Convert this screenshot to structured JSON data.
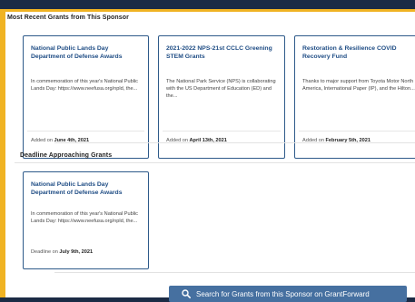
{
  "recent": {
    "heading": "Most Recent Grants from This Sponsor",
    "cards": [
      {
        "title": "National Public Lands Day Department of Defense Awards",
        "desc": "In commemoration of this year's National Public Lands Day: https://www.neefusa.org/npld, the...",
        "date_prefix": "Added on",
        "date": "June 4th, 2021"
      },
      {
        "title": "2021-2022 NPS-21st CCLC Greening STEM Grants",
        "desc": "The National Park Service (NPS) is collaborating with the US Department of Education (ED) and the...",
        "date_prefix": "Added on",
        "date": "April 13th, 2021"
      },
      {
        "title": "Restoration & Resilience COVID Recovery Fund",
        "desc": "Thanks to major support from Toyota Motor North America, International Paper (IP), and the Hilton...",
        "date_prefix": "Added on",
        "date": "February 5th, 2021"
      }
    ]
  },
  "deadline": {
    "heading": "Deadline Approaching Grants",
    "cards": [
      {
        "title": "National Public Lands Day Department of Defense Awards",
        "desc": "In commemoration of this year's National Public Lands Day: https://www.neefusa.org/npld, the...",
        "date_prefix": "Deadline on",
        "date": "July 9th, 2021"
      }
    ]
  },
  "search_button": {
    "label": "Search for Grants from this Sponsor on GrantForward",
    "icon": "search-icon"
  },
  "colors": {
    "frame": "#1b2b45",
    "accent_gold": "#f0b323",
    "card_title": "#1e4c84",
    "card_border": "#2e5a8a",
    "button": "#4670a0"
  }
}
